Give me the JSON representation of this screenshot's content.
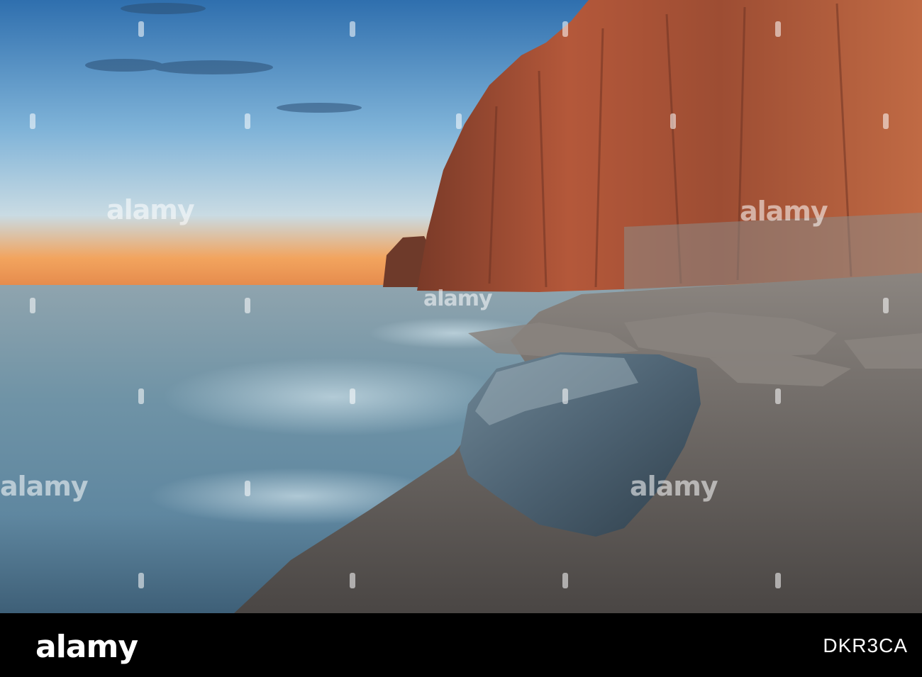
{
  "watermark": {
    "text": "alamy"
  },
  "footer": {
    "brand": "alamy",
    "image_code": "DKR3CA",
    "background": "#000000"
  },
  "scene": {
    "elements": [
      "sky",
      "sunset-horizon",
      "sea",
      "cliff",
      "pebble-beach",
      "boulder"
    ],
    "colors": {
      "sky_top": "#3f7fc0",
      "sky_horizon": "#f2a45e",
      "sea": "#7fa2b6",
      "cliff": "#b4583a",
      "beach": "#6f6a66",
      "boulder": "#4d6272"
    }
  }
}
